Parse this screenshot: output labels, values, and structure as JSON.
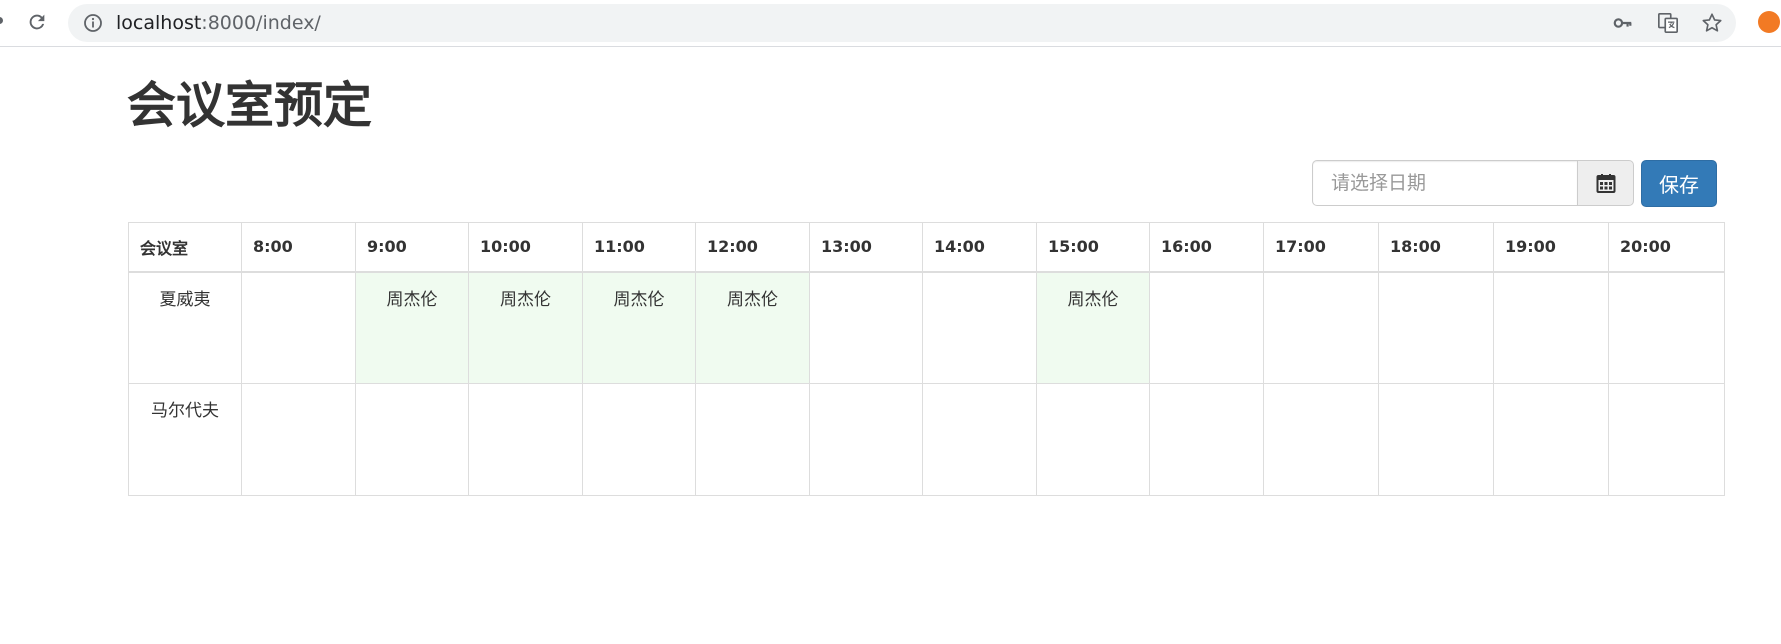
{
  "browser": {
    "url_host": "localhost",
    "url_rest": ":8000/index/"
  },
  "page": {
    "title": "会议室预定"
  },
  "toolbar": {
    "date_placeholder": "请选择日期",
    "save_label": "保存"
  },
  "table": {
    "room_header": "会议室",
    "hours": [
      "8:00",
      "9:00",
      "10:00",
      "11:00",
      "12:00",
      "13:00",
      "14:00",
      "15:00",
      "16:00",
      "17:00",
      "18:00",
      "19:00",
      "20:00"
    ],
    "rows": [
      {
        "room": "夏威夷",
        "slots": [
          "",
          "周杰伦",
          "周杰伦",
          "周杰伦",
          "周杰伦",
          "",
          "",
          "周杰伦",
          "",
          "",
          "",
          "",
          ""
        ]
      },
      {
        "room": "马尔代夫",
        "slots": [
          "",
          "",
          "",
          "",
          "",
          "",
          "",
          "",
          "",
          "",
          "",
          "",
          ""
        ]
      }
    ]
  },
  "colors": {
    "primary_button": "#337ab7",
    "booked_cell": "#f0fbf0",
    "border": "#dddddd"
  },
  "icons": [
    "reload-icon",
    "info-icon",
    "key-icon",
    "translate-icon",
    "star-icon",
    "extension-icon",
    "calendar-icon"
  ]
}
